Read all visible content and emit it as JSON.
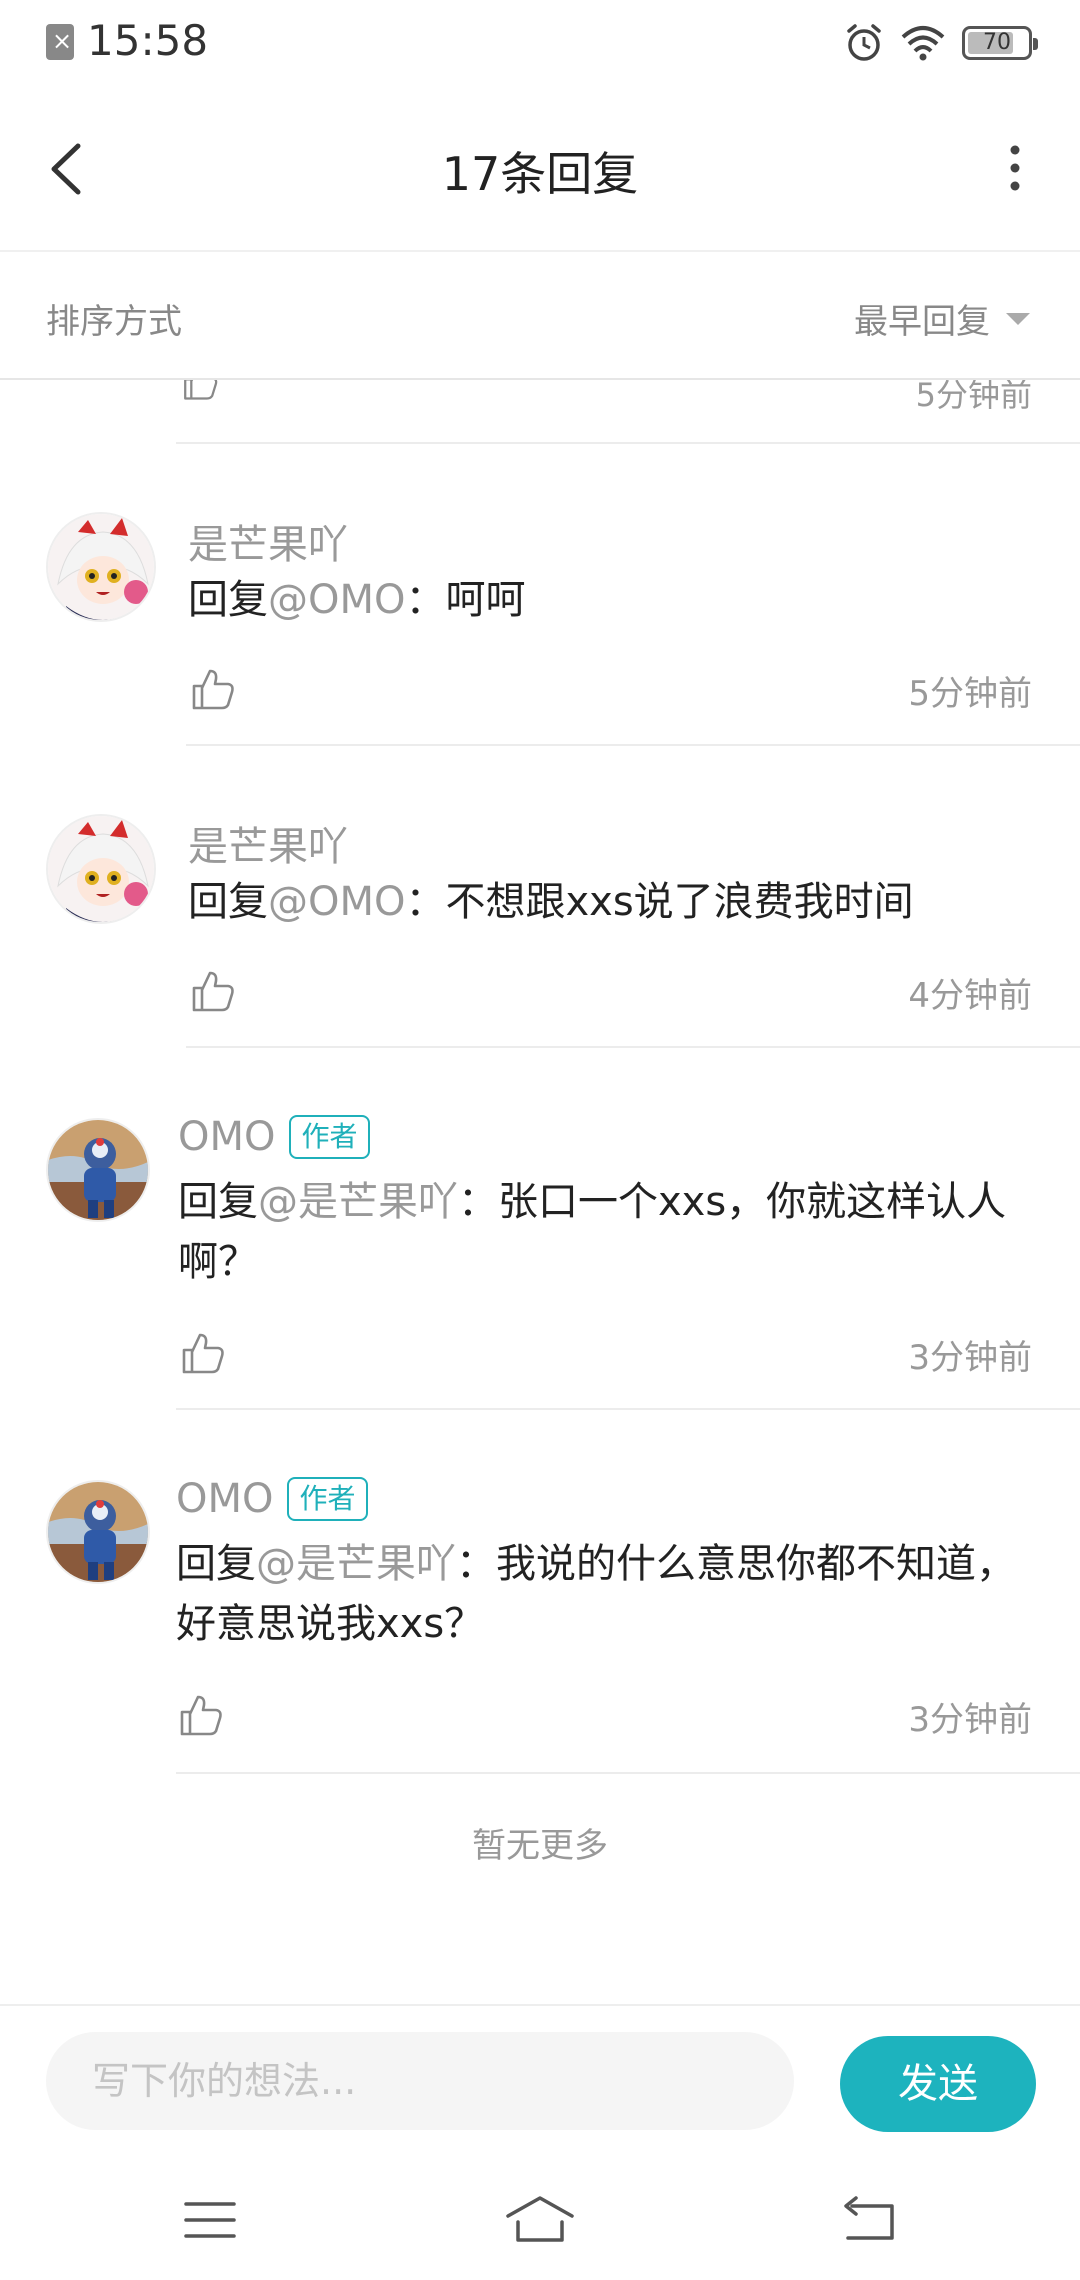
{
  "status_bar": {
    "time": "15:58",
    "battery": "70",
    "battery_level_percent": 70,
    "icons": [
      "sim-error-icon",
      "alarm-icon",
      "wifi-icon",
      "battery-icon"
    ]
  },
  "header": {
    "title": "17条回复",
    "back_icon": "chevron-left-icon",
    "more_icon": "more-vertical-icon"
  },
  "sort": {
    "label": "排序方式",
    "value": "最早回复"
  },
  "partial_item": {
    "time": "5分钟前"
  },
  "comments": [
    {
      "username": "是芒果吖",
      "is_author": false,
      "reply_prefix": "回复",
      "mention": "@OMO",
      "text": "：呵呵",
      "time": "5分钟前"
    },
    {
      "username": "是芒果吖",
      "is_author": false,
      "reply_prefix": "回复",
      "mention": "@OMO",
      "text": "：不想跟xxs说了浪费我时间",
      "time": "4分钟前"
    },
    {
      "username": "OMO",
      "is_author": true,
      "reply_prefix": "回复",
      "mention": "@是芒果吖",
      "text": "：张口一个xxs，你就这样认人啊？",
      "time": "3分钟前"
    },
    {
      "username": "OMO",
      "is_author": true,
      "reply_prefix": "回复",
      "mention": "@是芒果吖",
      "text": "：我说的什么意思你都不知道，好意思说我xxs？",
      "time": "3分钟前"
    }
  ],
  "author_badge": "作者",
  "footer_text": "暂无更多",
  "input": {
    "placeholder": "写下你的想法...",
    "send_label": "发送"
  },
  "colors": {
    "accent": "#1db3be",
    "muted_text": "#999999",
    "primary_text": "#222222"
  },
  "nav": {
    "icons": [
      "menu-icon",
      "home-icon",
      "back-icon"
    ]
  }
}
